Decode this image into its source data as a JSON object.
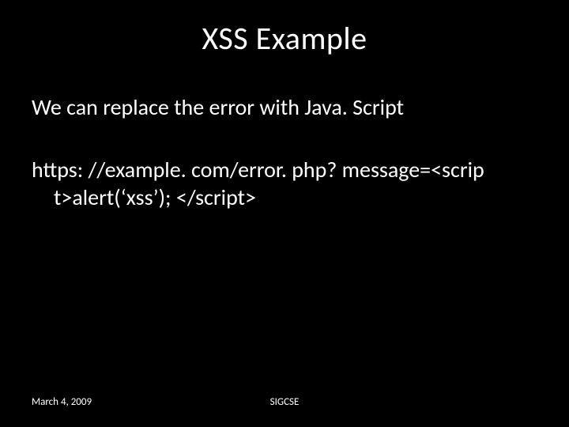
{
  "slide": {
    "title": "XSS Example",
    "body": {
      "line1": "We can replace the error with Java. Script",
      "line2": "https: //example. com/error. php? message=<scrip t>alert(‘xss’); </script>"
    },
    "footer": {
      "date": "March 4, 2009",
      "venue": "SIGCSE"
    }
  }
}
